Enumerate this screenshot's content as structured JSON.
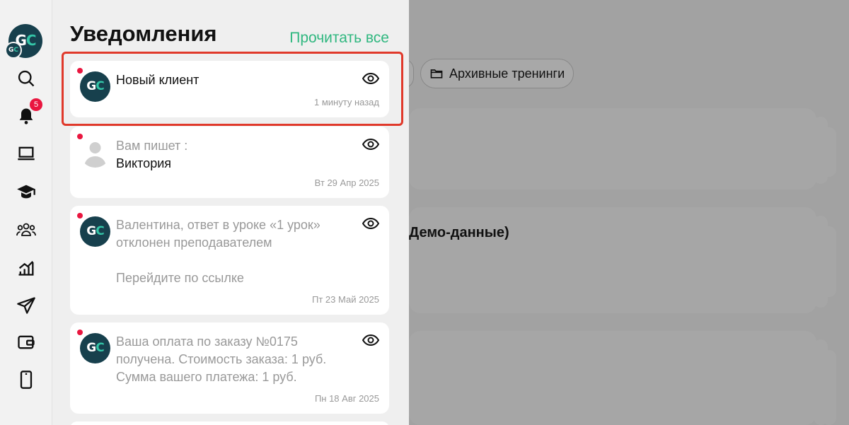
{
  "panel": {
    "title": "Уведомления",
    "read_all": "Прочитать все"
  },
  "rail": {
    "logo_text_a": "G",
    "logo_text_b": "C",
    "mini_logo_a": "G",
    "mini_logo_b": "C",
    "notification_count": "5",
    "icons": [
      "search-icon",
      "bell-icon",
      "laptop-icon",
      "graduation-cap-icon",
      "users-icon",
      "chart-icon",
      "send-icon",
      "wallet-icon",
      "phone-icon"
    ]
  },
  "background": {
    "archive_label": "Архивные тренинги",
    "card_text": "Демо-данные)"
  },
  "notifications": [
    {
      "avatar": "gc-logo",
      "lines": [
        "Новый клиент"
      ],
      "time": "1 минуту назад"
    },
    {
      "avatar": "person",
      "lines_muted": [
        "Вам пишет :"
      ],
      "lines": [
        "Виктория"
      ],
      "time": "Вт 29 Апр 2025"
    },
    {
      "avatar": "gc-logo",
      "lines_muted": [
        "Валентина, ответ в уроке «1 урок»",
        "отклонен преподавателем",
        "",
        "Перейдите по ссылке"
      ],
      "time": "Пт 23 Май 2025"
    },
    {
      "avatar": "gc-logo",
      "lines_muted": [
        "Ваша оплата по заказу №0175",
        "получена. Стоимость заказа: 1 руб.",
        "Сумма вашего платежа: 1 руб."
      ],
      "time": "Пн 18 Авг 2025"
    }
  ],
  "colors": {
    "accent_green": "#2fb77f",
    "badge_red": "#e9163f",
    "logo_dark": "#17404d",
    "logo_teal": "#34c6a8",
    "highlight_red": "#e0392b"
  }
}
